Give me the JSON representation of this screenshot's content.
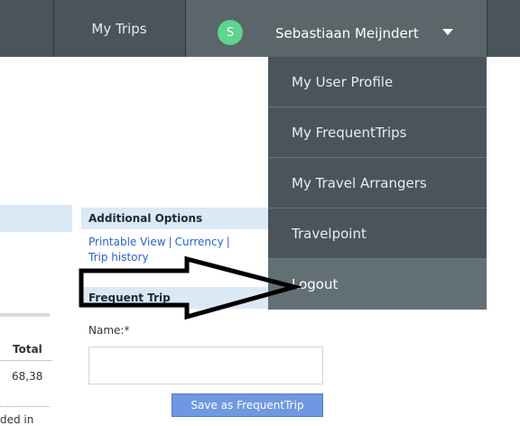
{
  "nav": {
    "my_trips": "My Trips",
    "avatar_initial": "S",
    "user_name": "Sebastiaan Meijndert",
    "caret_icon": "caret-down-icon"
  },
  "dropdown": {
    "items": [
      {
        "label": "My User Profile"
      },
      {
        "label": "My FrequentTrips"
      },
      {
        "label": "My Travel Arrangers"
      },
      {
        "label": "Travelpoint"
      },
      {
        "label": "Logout"
      }
    ]
  },
  "left": {
    "total_label": "Total",
    "amount": "68,38",
    "cut_text": "ded in"
  },
  "options": {
    "title": "Additional Options",
    "printable_view": "Printable View",
    "currency": "Currency",
    "trip_history": "Trip history"
  },
  "frequent": {
    "title": "Frequent Trip",
    "name_label": "Name:*",
    "name_value": "",
    "save_label": "Save as FrequentTrip"
  },
  "colors": {
    "nav_bg": "#4a555b",
    "avatar": "#5fd48c",
    "link": "#2a62c9",
    "button": "#6f98e2"
  }
}
